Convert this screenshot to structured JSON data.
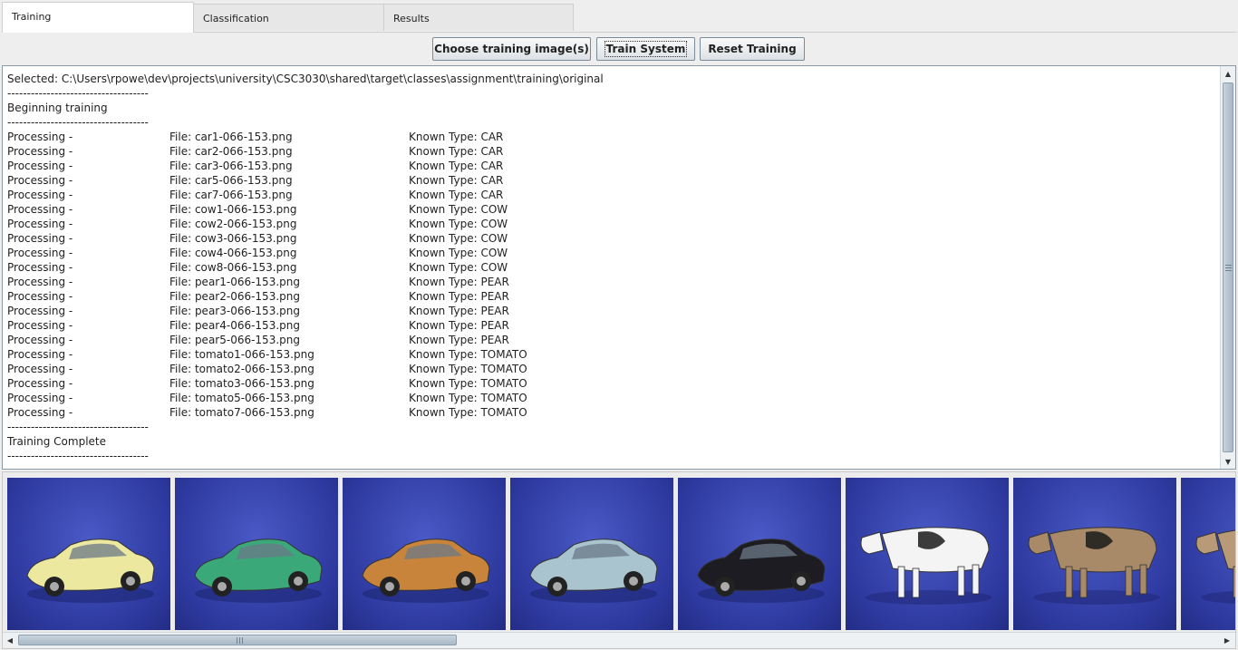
{
  "tabs": [
    {
      "label": "Training",
      "active": true
    },
    {
      "label": "Classification",
      "active": false
    },
    {
      "label": "Results",
      "active": false
    }
  ],
  "toolbar": {
    "choose_label": "Choose training image(s)",
    "train_label": "Train System",
    "reset_label": "Reset Training"
  },
  "log": {
    "selected": "Selected: C:\\Users\\rpowe\\dev\\projects\\university\\CSC3030\\shared\\target\\classes\\assignment\\training\\original",
    "separator": "------------------------------------",
    "beginning": "Beginning training",
    "complete": "Training Complete",
    "rows": [
      {
        "action": "Processing -",
        "file": "File: car1-066-153.png",
        "type": "Known Type: CAR"
      },
      {
        "action": "Processing -",
        "file": "File: car2-066-153.png",
        "type": "Known Type: CAR"
      },
      {
        "action": "Processing -",
        "file": "File: car3-066-153.png",
        "type": "Known Type: CAR"
      },
      {
        "action": "Processing -",
        "file": "File: car5-066-153.png",
        "type": "Known Type: CAR"
      },
      {
        "action": "Processing -",
        "file": "File: car7-066-153.png",
        "type": "Known Type: CAR"
      },
      {
        "action": "Processing -",
        "file": "File: cow1-066-153.png",
        "type": "Known Type: COW"
      },
      {
        "action": "Processing -",
        "file": "File: cow2-066-153.png",
        "type": "Known Type: COW"
      },
      {
        "action": "Processing -",
        "file": "File: cow3-066-153.png",
        "type": "Known Type: COW"
      },
      {
        "action": "Processing -",
        "file": "File: cow4-066-153.png",
        "type": "Known Type: COW"
      },
      {
        "action": "Processing -",
        "file": "File: cow8-066-153.png",
        "type": "Known Type: COW"
      },
      {
        "action": "Processing -",
        "file": "File: pear1-066-153.png",
        "type": "Known Type: PEAR"
      },
      {
        "action": "Processing -",
        "file": "File: pear2-066-153.png",
        "type": "Known Type: PEAR"
      },
      {
        "action": "Processing -",
        "file": "File: pear3-066-153.png",
        "type": "Known Type: PEAR"
      },
      {
        "action": "Processing -",
        "file": "File: pear4-066-153.png",
        "type": "Known Type: PEAR"
      },
      {
        "action": "Processing -",
        "file": "File: pear5-066-153.png",
        "type": "Known Type: PEAR"
      },
      {
        "action": "Processing -",
        "file": "File: tomato1-066-153.png",
        "type": "Known Type: TOMATO"
      },
      {
        "action": "Processing -",
        "file": "File: tomato2-066-153.png",
        "type": "Known Type: TOMATO"
      },
      {
        "action": "Processing -",
        "file": "File: tomato3-066-153.png",
        "type": "Known Type: TOMATO"
      },
      {
        "action": "Processing -",
        "file": "File: tomato5-066-153.png",
        "type": "Known Type: TOMATO"
      },
      {
        "action": "Processing -",
        "file": "File: tomato7-066-153.png",
        "type": "Known Type: TOMATO"
      }
    ]
  },
  "thumbnails": [
    {
      "subject": "car",
      "color": "#ece8a0"
    },
    {
      "subject": "car",
      "color": "#3aa878"
    },
    {
      "subject": "car",
      "color": "#c8843a"
    },
    {
      "subject": "car",
      "color": "#a9c3cf"
    },
    {
      "subject": "car",
      "color": "#1c1c22"
    },
    {
      "subject": "cow",
      "color": "#f4f4f4"
    },
    {
      "subject": "cow",
      "color": "#a98a68"
    },
    {
      "subject": "cow",
      "color": "#b89a78"
    }
  ],
  "colors": {
    "image_background": "#3342b0",
    "focus_outline": "#333333"
  }
}
